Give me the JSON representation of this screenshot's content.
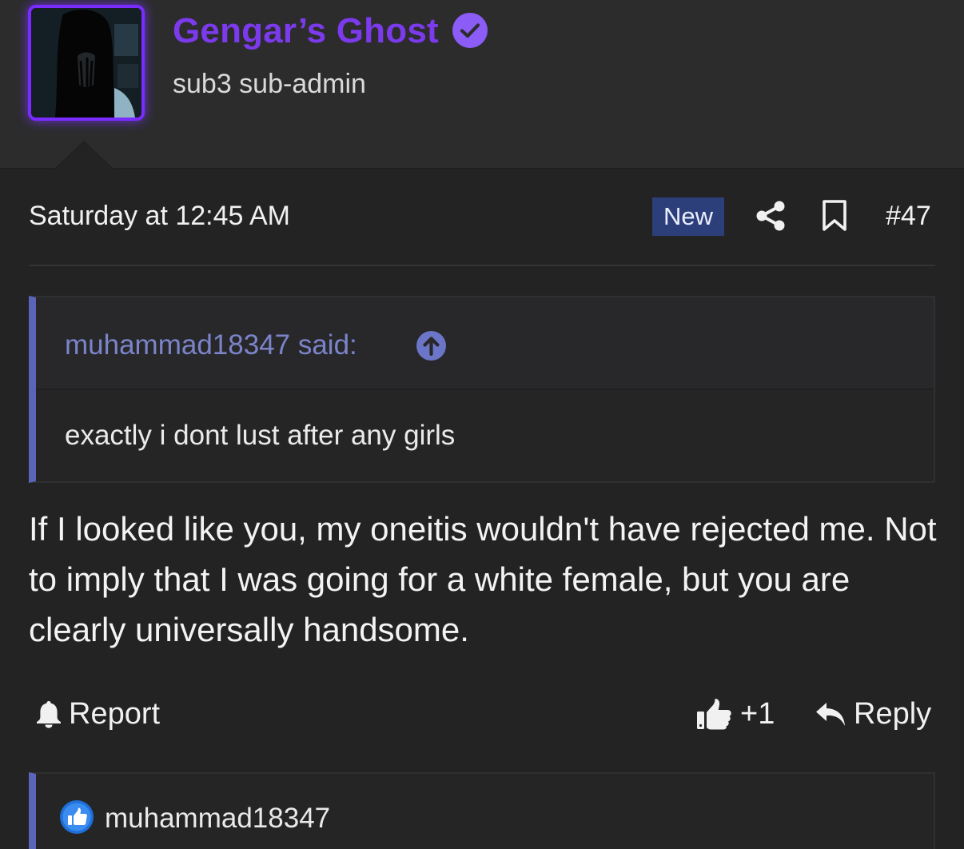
{
  "user": {
    "name": "Gengar’s Ghost",
    "title": "sub3 sub-admin",
    "name_color": "#7c3aed",
    "verified_color": "#8b5cf6"
  },
  "post": {
    "date": "Saturday at 12:45 AM",
    "badge": "New",
    "number": "#47",
    "quote": {
      "author_line": "muhammad18347 said:",
      "text": "exactly i dont lust after any girls"
    },
    "body": "If I looked like you, my oneitis wouldn't have rejected me. Not to imply that I was going for a white female, but you are clearly universally handsome."
  },
  "actions": {
    "report": "Report",
    "like_count": "+1",
    "reply": "Reply"
  },
  "reactions": {
    "user": "muhammad18347"
  },
  "icons": {
    "verified": "verified-check-icon",
    "share": "share-icon",
    "bookmark": "bookmark-icon",
    "quote_jump": "arrow-up-circle-icon",
    "report": "bell-icon",
    "like": "thumbs-up-icon",
    "reply": "reply-arrow-icon",
    "reaction": "like-reaction-icon"
  },
  "colors": {
    "accent_blue": "#5a64b8",
    "badge_bg": "#2d3f7a"
  }
}
